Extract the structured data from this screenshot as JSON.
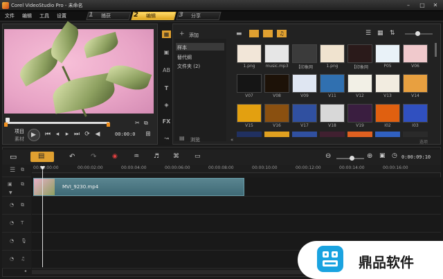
{
  "app": {
    "title": "Corel VideoStudio Pro - 未命名"
  },
  "menu": [
    "文件",
    "编辑",
    "工具",
    "设置"
  ],
  "steps": [
    {
      "num": "1",
      "label": "捕获"
    },
    {
      "num": "2",
      "label": "编辑"
    },
    {
      "num": "3",
      "label": "分享"
    }
  ],
  "preview": {
    "project_label": "项目",
    "clip_label": "素材",
    "timecode": "00:00:0",
    "zoom_icon": "zoom-icon"
  },
  "library": {
    "add_label": "添加",
    "folders": [
      "样本",
      "替代纲",
      "文件夹 (2)"
    ],
    "browse_label": "浏览",
    "options_label": "选项",
    "thumbs": [
      {
        "label": "1.png",
        "color": "#f2e6d8"
      },
      {
        "label": "music.mp3",
        "color": "#e6e6e6"
      },
      {
        "label": "【印象网",
        "color": "#3b3b3b"
      },
      {
        "label": "1.png",
        "color": "#f0e3cf"
      },
      {
        "label": "【印象网",
        "color": "#2a1a1a"
      },
      {
        "label": "P05",
        "color": "#e9f2f8"
      },
      {
        "label": "V06",
        "color": "#f0c9cc"
      },
      {
        "label": "V07",
        "color": "#151515"
      },
      {
        "label": "V08",
        "color": "#1d1208"
      },
      {
        "label": "V09",
        "color": "#dfe6f2"
      },
      {
        "label": "V11",
        "color": "#3070b0"
      },
      {
        "label": "V12",
        "color": "#f2f0e6"
      },
      {
        "label": "V13",
        "color": "#f2ece0"
      },
      {
        "label": "V14",
        "color": "#e8a040"
      },
      {
        "label": "V15",
        "color": "#e3a010"
      },
      {
        "label": "V16",
        "color": "#8a5010"
      },
      {
        "label": "V17",
        "color": "#3050a0"
      },
      {
        "label": "V18",
        "color": "#d8d8d8"
      },
      {
        "label": "V19",
        "color": "#3a1e40"
      },
      {
        "label": "I02",
        "color": "#e06010"
      },
      {
        "label": "I03",
        "color": "#3050c0"
      }
    ]
  },
  "timeline": {
    "ticks": [
      "00:00:00:00",
      "00:00:02:00",
      "00:00:04:00",
      "00:00:06:00",
      "00:00:08:00",
      "00:00:10:00",
      "00:00:12:00",
      "00:00:14:00",
      "00:00:16:00"
    ],
    "clip_label": "MVI_9230.mp4",
    "duration": "0:00:09:10"
  },
  "watermark": {
    "text": "鼎品软件"
  },
  "colors": {
    "accent": "#f0c040",
    "clip": "#4f7a86",
    "background": "#1a1a1a"
  }
}
